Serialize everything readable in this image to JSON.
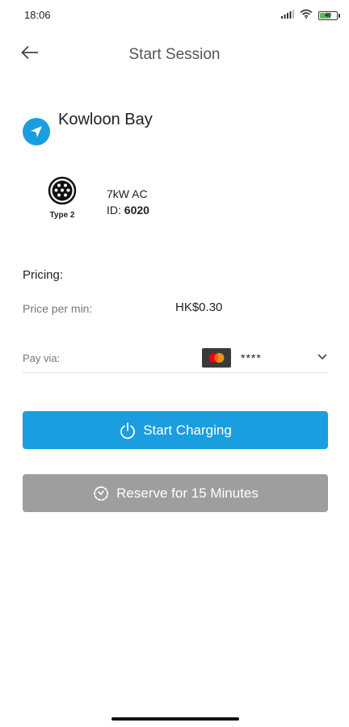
{
  "status_bar": {
    "time": "18:06",
    "battery_text": "40",
    "icons": [
      "signal-icon",
      "wifi-icon",
      "battery-icon"
    ]
  },
  "header": {
    "title": "Start Session",
    "back_icon": "back-arrow-icon"
  },
  "location": {
    "name": "Kowloon Bay",
    "icon": "navigation-icon",
    "icon_color": "#1a9ee0"
  },
  "connector": {
    "type_label": "Type 2",
    "power": "7kW AC",
    "id_prefix": "ID: ",
    "id_value": "6020"
  },
  "pricing": {
    "title": "Pricing:",
    "price_per_min_label": "Price per min:",
    "price_per_min_value": "HK$0.30"
  },
  "payment": {
    "label": "Pay via:",
    "card_icon": "mastercard-icon",
    "card_number": "****"
  },
  "actions": {
    "start_label": "Start Charging",
    "start_color": "#1a9ee0",
    "reserve_label": "Reserve for 15 Minutes",
    "reserve_color": "#9e9e9e"
  }
}
